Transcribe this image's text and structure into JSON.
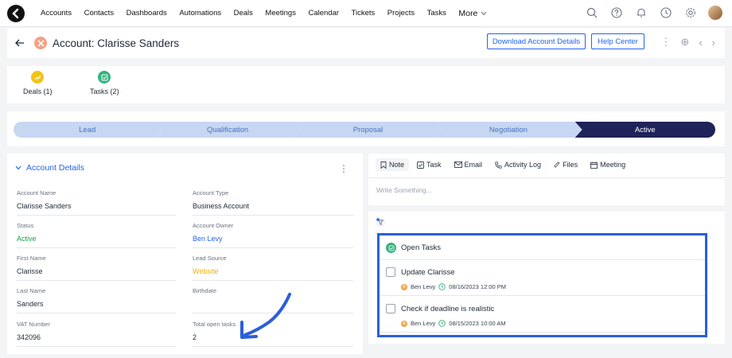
{
  "nav": {
    "items": [
      "Accounts",
      "Contacts",
      "Dashboards",
      "Automations",
      "Deals",
      "Meetings",
      "Calendar",
      "Tickets",
      "Projects",
      "Tasks"
    ],
    "more_label": "More"
  },
  "header": {
    "title": "Account: Clarisse Sanders",
    "download_label": "Download Account Details",
    "help_label": "Help Center"
  },
  "summary": {
    "deals_label": "Deals (1)",
    "tasks_label": "Tasks (2)"
  },
  "pipeline": {
    "stages": [
      "Lead",
      "Qualification",
      "Proposal",
      "Negotiation",
      "Active"
    ],
    "active_index": 4
  },
  "details": {
    "title": "Account Details",
    "fields": {
      "account_name": {
        "label": "Account Name",
        "value": "Clarisse Sanders"
      },
      "account_type": {
        "label": "Account Type",
        "value": "Business Account"
      },
      "status": {
        "label": "Status",
        "value": "Active"
      },
      "account_owner": {
        "label": "Account Owner",
        "value": "Ben Levy"
      },
      "first_name": {
        "label": "First Name",
        "value": "Clarisse"
      },
      "lead_source": {
        "label": "Lead Source",
        "value": "Website"
      },
      "last_name": {
        "label": "Last Name",
        "value": "Sanders"
      },
      "birthdate": {
        "label": "Birthdate",
        "value": ""
      },
      "vat_number": {
        "label": "VAT Number",
        "value": "342096"
      },
      "total_open_tasks": {
        "label": "Total open tasks",
        "value": "2"
      }
    }
  },
  "activity": {
    "tabs": [
      "Note",
      "Task",
      "Email",
      "Activity Log",
      "Files",
      "Meeting"
    ],
    "note_placeholder": "Write Something..."
  },
  "open_tasks": {
    "title": "Open Tasks",
    "items": [
      {
        "title": "Update Clarisse",
        "owner_initial": "B",
        "owner": "Ben Levy",
        "due": "08/16/2023 12:00 PM"
      },
      {
        "title": "Check if deadline is realistic",
        "owner_initial": "B",
        "owner": "Ben Levy",
        "due": "08/15/2023 10:00 AM"
      }
    ]
  },
  "colors": {
    "accent": "#2563eb",
    "status_active": "#16a34a",
    "lead_source": "#eab308",
    "pipeline_inactive": "#c7d7f2",
    "pipeline_active": "#1f2359",
    "highlight_border": "#2b5fd9"
  }
}
